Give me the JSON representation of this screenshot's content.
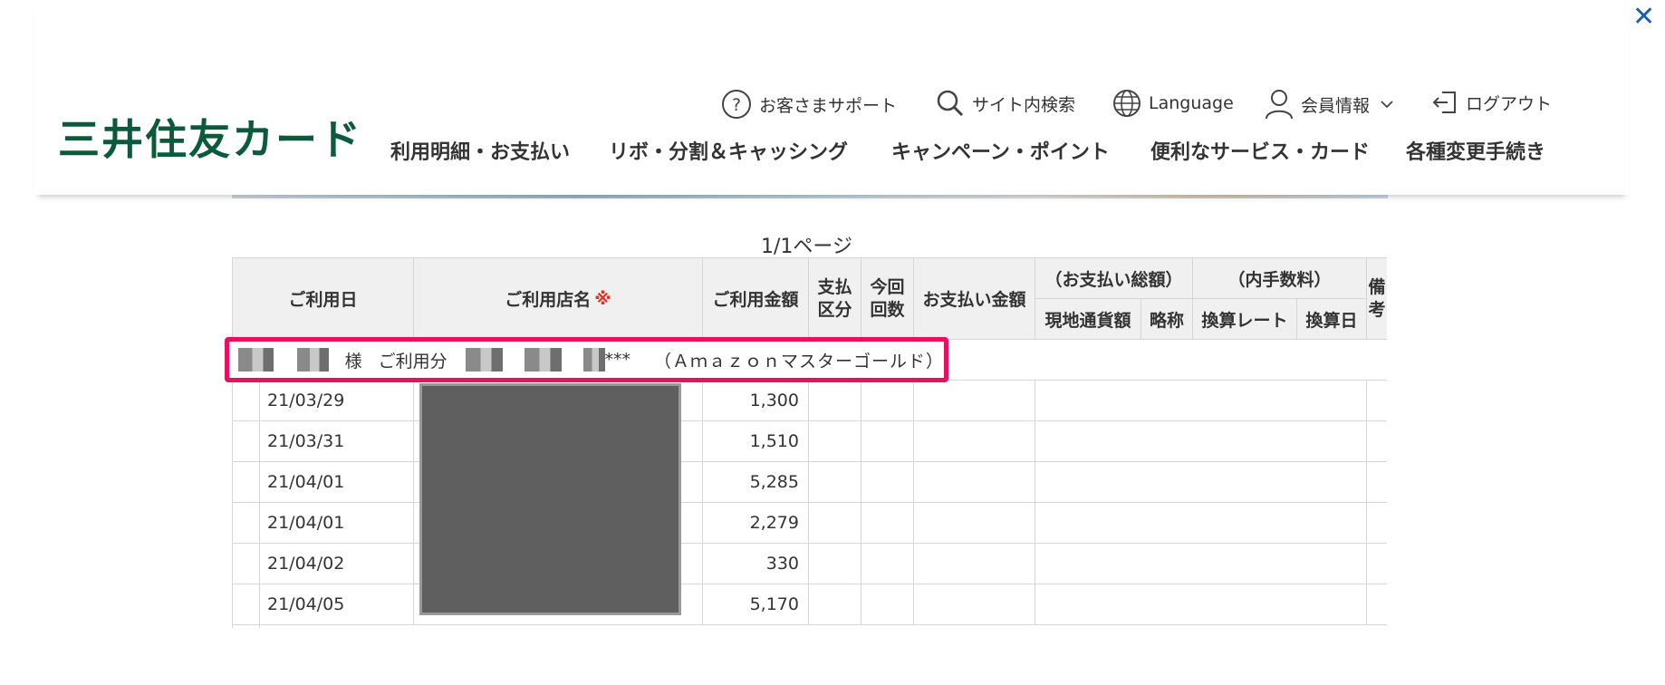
{
  "header": {
    "logo": "三井住友カード",
    "utility": [
      {
        "id": "support",
        "label": "お客さまサポート",
        "icon": "question-circle-icon"
      },
      {
        "id": "search",
        "label": "サイト内検索",
        "icon": "search-icon"
      },
      {
        "id": "language",
        "label": "Language",
        "icon": "globe-icon"
      },
      {
        "id": "member",
        "label": "会員情報",
        "icon": "user-icon"
      },
      {
        "id": "logout",
        "label": "ログアウト",
        "icon": "logout-icon"
      }
    ],
    "nav": [
      "利用明細・お支払い",
      "リボ・分割＆キャッシング",
      "キャンペーン・ポイント",
      "便利なサービス・カード",
      "各種変更手続き"
    ]
  },
  "page_info": "1/1ページ",
  "table": {
    "headers": {
      "date": "ご利用日",
      "store": "ご利用店名",
      "store_mark": "※",
      "amount": "ご利用金額",
      "pay_type_1": "支払",
      "pay_type_2": "区分",
      "count_1": "今回",
      "count_2": "回数",
      "payment": "お支払い金額",
      "total": "（お支払い総額）",
      "local": "現地通貨額",
      "abbr": "略称",
      "fee": "（内手数料）",
      "rate": "換算レート",
      "conv_date": "換算日",
      "remarks_1": "備",
      "remarks_2": "考"
    },
    "card_row": {
      "sama": "様",
      "usage": "ご利用分",
      "masked": "***",
      "card_name": "（Ａｍａｚｏｎマスターゴールド）"
    },
    "rows": [
      {
        "date": "21/03/29",
        "amount": "1,300"
      },
      {
        "date": "21/03/31",
        "amount": "1,510"
      },
      {
        "date": "21/04/01",
        "amount": "5,285"
      },
      {
        "date": "21/04/01",
        "amount": "2,279"
      },
      {
        "date": "21/04/02",
        "amount": "330"
      },
      {
        "date": "21/04/05",
        "amount": "5,170"
      }
    ]
  },
  "colors": {
    "brand": "#0b5a3c",
    "highlight": "#e8115f",
    "link": "#1a5fb4"
  }
}
